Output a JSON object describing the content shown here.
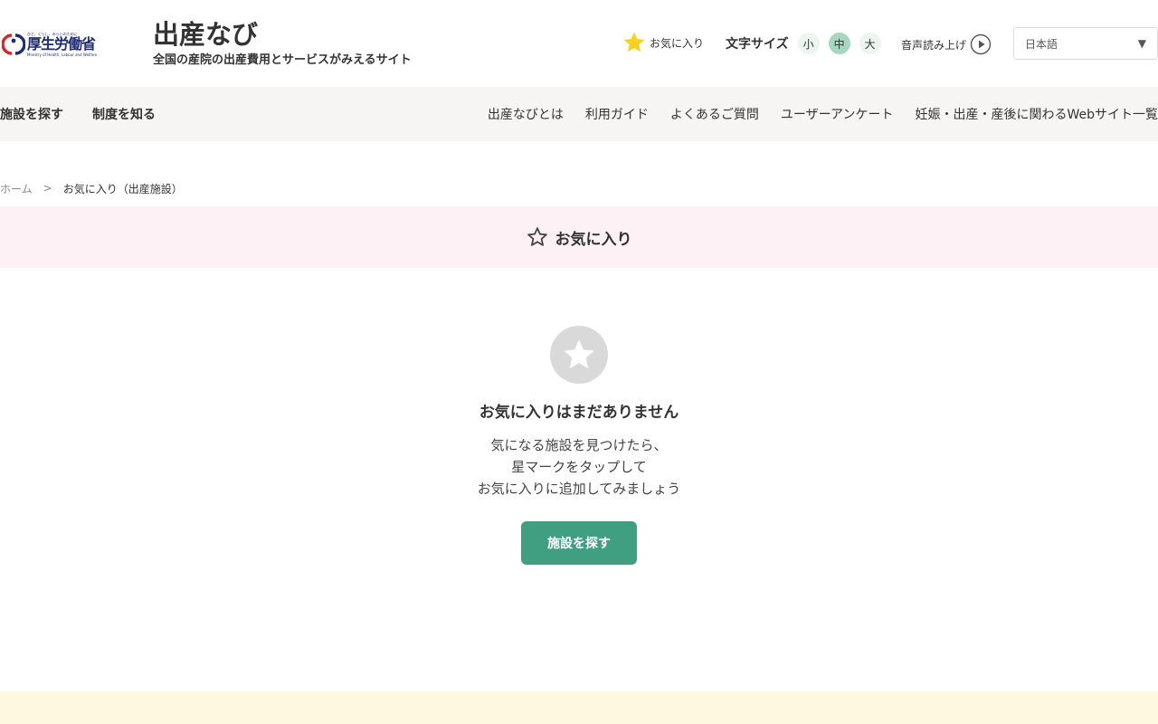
{
  "header": {
    "ministry_logo": {
      "tagline": "ひと、くらし、みらいのために",
      "name": "厚生労働省",
      "name_en": "Ministry of Health, Labour and Welfare"
    },
    "site_title": "出産なび",
    "site_subtitle": "全国の産院の出産費用とサービスがみえるサイト",
    "favorites_label": "お気に入り",
    "font_size": {
      "label": "文字サイズ",
      "small": "小",
      "medium": "中",
      "large": "大",
      "selected": "中"
    },
    "tts_label": "音声読み上げ",
    "language": {
      "selected": "日本語"
    }
  },
  "nav": {
    "left": [
      {
        "label": "施設を探す"
      },
      {
        "label": "制度を知る"
      }
    ],
    "right": [
      {
        "label": "出産なびとは"
      },
      {
        "label": "利用ガイド"
      },
      {
        "label": "よくあるご質問"
      },
      {
        "label": "ユーザーアンケート"
      },
      {
        "label": "妊娠・出産・産後に関わるWebサイト一覧"
      }
    ]
  },
  "breadcrumb": {
    "home": "ホーム",
    "separator": ">",
    "current": "お気に入り（出産施設）"
  },
  "page": {
    "heading": "お気に入り"
  },
  "empty_state": {
    "title": "お気に入りはまだありません",
    "lines": [
      "気になる施設を見つけたら、",
      "星マークをタップして",
      "お気に入りに追加してみましょう"
    ],
    "button_label": "施設を探す"
  },
  "colors": {
    "accent_green": "#3f9f80",
    "heading_band": "#fdf1f6",
    "nav_bg": "#f6f5f3",
    "footer_band": "#fff8e1",
    "star_yellow": "#f7d21a",
    "ministry_blue": "#1d2b78",
    "ministry_red": "#d9262c"
  },
  "icons": {
    "header_favorite": "star-filled-icon",
    "tts": "play-circle-icon",
    "language": "chevron-down-icon",
    "heading": "star-outline-icon",
    "empty": "star-circle-icon"
  }
}
